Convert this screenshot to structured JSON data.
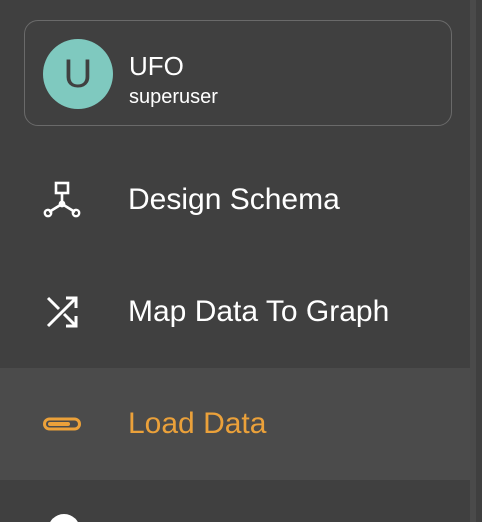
{
  "user": {
    "avatar_initial": "U",
    "name": "UFO",
    "role": "superuser"
  },
  "nav": {
    "items": [
      {
        "label": "Design Schema",
        "icon": "schema-graph-icon",
        "active": false
      },
      {
        "label": "Map Data To Graph",
        "icon": "shuffle-icon",
        "active": false
      },
      {
        "label": "Load Data",
        "icon": "progress-bar-icon",
        "active": true
      }
    ]
  },
  "colors": {
    "background": "#404040",
    "active_background": "#4b4b4b",
    "accent": "#eba13a",
    "avatar": "#7fc9bf",
    "text": "#ffffff"
  }
}
